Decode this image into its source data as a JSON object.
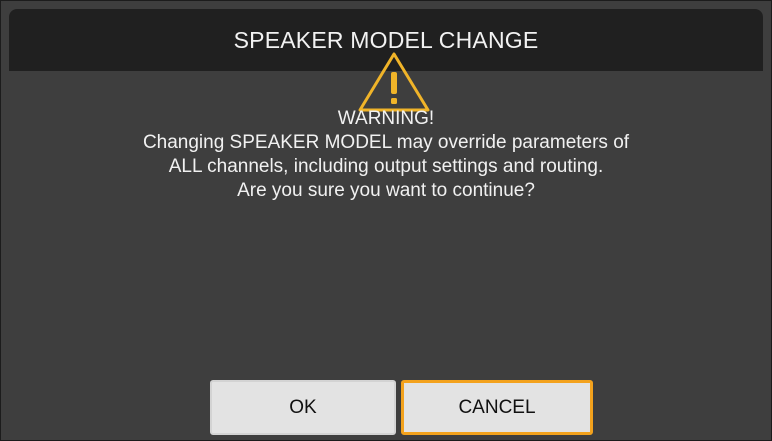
{
  "dialog": {
    "title": "SPEAKER MODEL CHANGE",
    "icon": "warning-triangle-icon",
    "accent_color": "#F3A21D",
    "message": {
      "heading": "WARNING!",
      "lines": [
        "Changing SPEAKER MODEL may override parameters of",
        "ALL channels, including output settings and routing.",
        "Are you sure you want to continue?"
      ]
    },
    "buttons": {
      "ok_label": "OK",
      "cancel_label": "CANCEL",
      "focused": "CANCEL"
    }
  }
}
